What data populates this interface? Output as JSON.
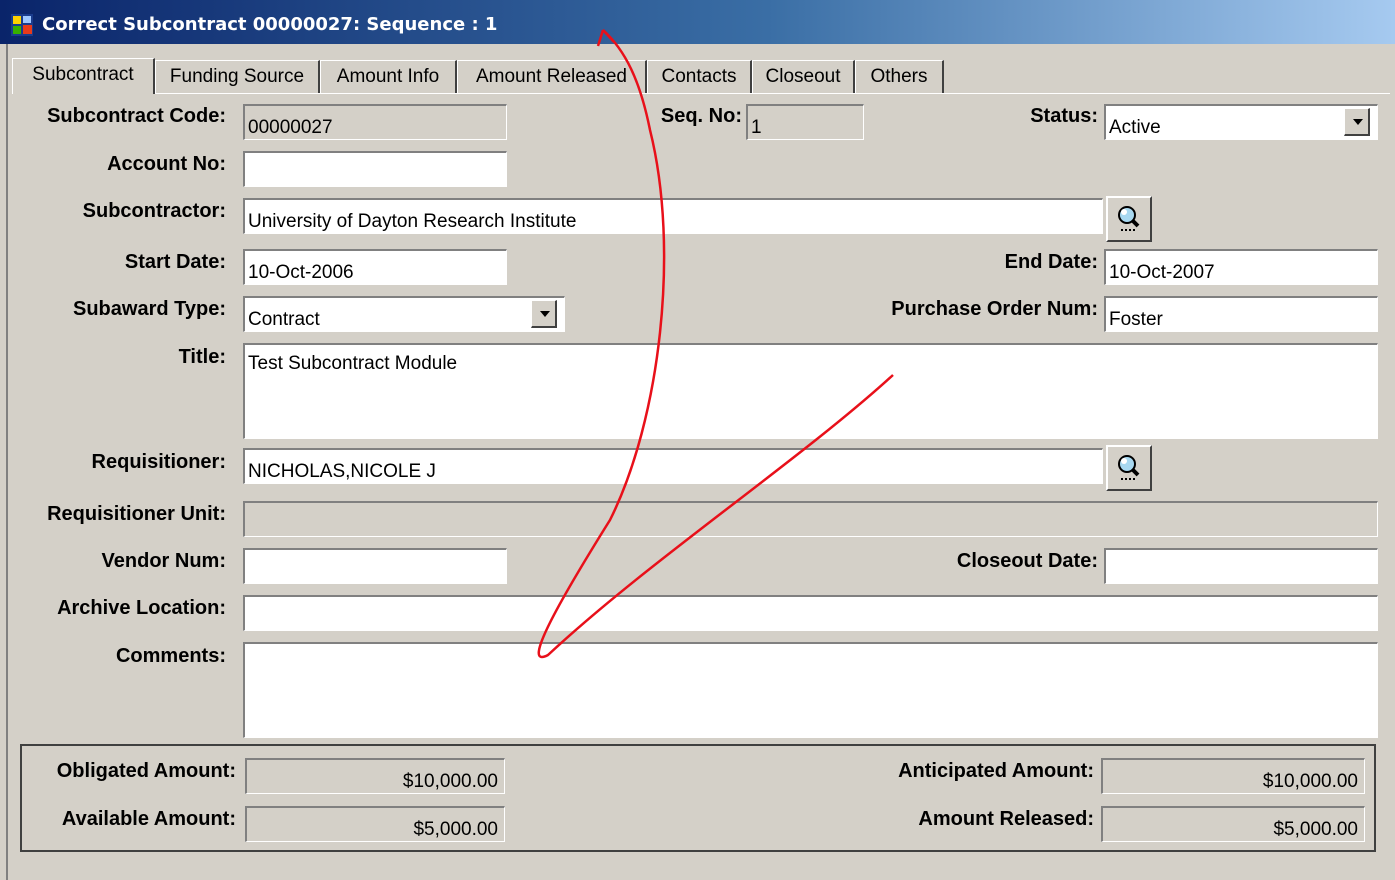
{
  "window": {
    "title": "Correct Subcontract 00000027: Sequence : 1",
    "icon": "oracle-forms-app-icon",
    "colors": {
      "titlebar_start": "#0a246a",
      "titlebar_end": "#a6caf0",
      "face": "#d4d0c8",
      "annotation": "#e8101a"
    }
  },
  "tabs": [
    {
      "label": "Subcontract",
      "active": true
    },
    {
      "label": "Funding Source",
      "active": false
    },
    {
      "label": "Amount Info",
      "active": false
    },
    {
      "label": "Amount Released",
      "active": false
    },
    {
      "label": "Contacts",
      "active": false
    },
    {
      "label": "Closeout",
      "active": false
    },
    {
      "label": "Others",
      "active": false
    }
  ],
  "form": {
    "subcontract_code": {
      "label": "Subcontract Code:",
      "value": "00000027"
    },
    "seq_no": {
      "label": "Seq. No:",
      "value": "1"
    },
    "status": {
      "label": "Status:",
      "value": "Active"
    },
    "account_no": {
      "label": "Account No:",
      "value": ""
    },
    "subcontractor": {
      "label": "Subcontractor:",
      "value": "University of Dayton Research Institute",
      "lookup_icon": "search-magnifier-icon"
    },
    "start_date": {
      "label": "Start Date:",
      "value": "10-Oct-2006"
    },
    "end_date": {
      "label": "End Date:",
      "value": "10-Oct-2007"
    },
    "subaward_type": {
      "label": "Subaward Type:",
      "value": "Contract"
    },
    "purchase_order_num": {
      "label": "Purchase Order Num:",
      "value": "Foster"
    },
    "title": {
      "label": "Title:",
      "value": "Test Subcontract Module"
    },
    "requisitioner": {
      "label": "Requisitioner:",
      "value": "NICHOLAS,NICOLE J",
      "lookup_icon": "search-magnifier-icon"
    },
    "requisitioner_unit": {
      "label": "Requisitioner Unit:",
      "value": ""
    },
    "vendor_num": {
      "label": "Vendor Num:",
      "value": ""
    },
    "closeout_date": {
      "label": "Closeout Date:",
      "value": ""
    },
    "archive_location": {
      "label": "Archive Location:",
      "value": ""
    },
    "comments": {
      "label": "Comments:",
      "value": ""
    }
  },
  "totals": {
    "obligated_amount": {
      "label": "Obligated Amount:",
      "value": "$10,000.00"
    },
    "anticipated_amount": {
      "label": "Anticipated Amount:",
      "value": "$10,000.00"
    },
    "available_amount": {
      "label": "Available Amount:",
      "value": "$5,000.00"
    },
    "amount_released": {
      "label": "Amount Released:",
      "value": "$5,000.00"
    }
  }
}
